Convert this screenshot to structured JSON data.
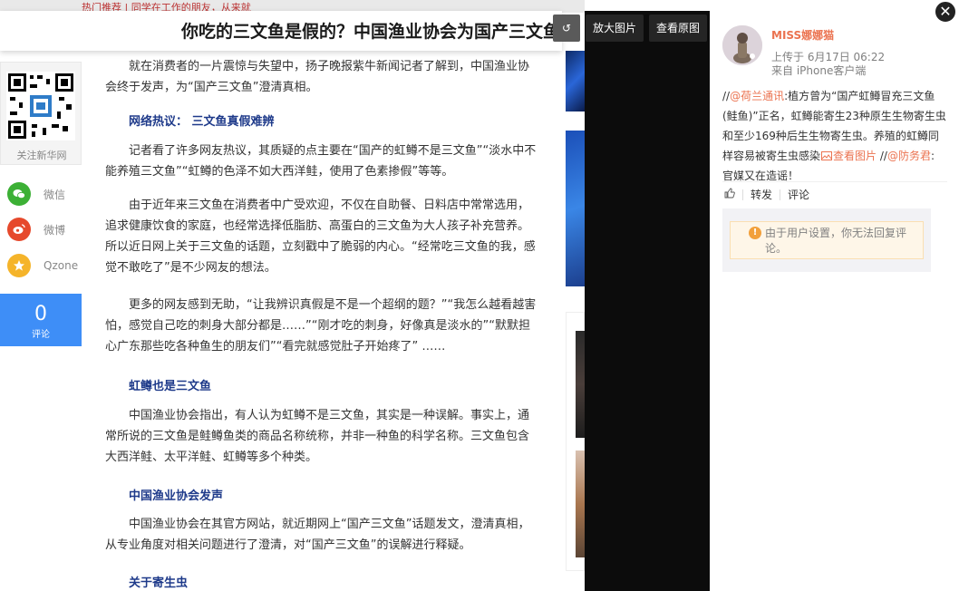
{
  "article": {
    "title": "你吃的三文鱼是假的？中国渔业协会为国产三文鱼正名",
    "top_fragment": "热门推荐 | 同学在工作的朋友，从来就",
    "paragraphs": [
      "就在消费者的一片震惊与失望中，扬子晚报紫牛新闻记者了解到，中国渔业协会终于发声，为“国产三文鱼”澄清真相。",
      "记者看了许多网友热议，其质疑的点主要在“国产的虹鳟不是三文鱼”“淡水中不能养殖三文鱼”“虹鳟的色泽不如大西洋鲑，使用了色素掺假”等等。",
      "由于近年来三文鱼在消费者中广受欢迎，不仅在自助餐、日料店中常常选用，追求健康饮食的家庭，也经常选择低脂肪、高蛋白的三文鱼为大人孩子补充营养。所以近日网上关于三文鱼的话题，立刻戳中了脆弱的内心。“经常吃三文鱼的我，感觉不敢吃了”是不少网友的想法。",
      "更多的网友感到无助，“让我辨识真假是不是一个超纲的题？”“我怎么越看越害怕，感觉自己吃的刺身大部分都是……”“刚才吃的刺身，好像真是淡水的”“默默担心广东那些吃各种鱼生的朋友们”“看完就感觉肚子开始疼了” ……",
      "中国渔业协会指出，有人认为虹鳟不是三文鱼，其实是一种误解。事实上，通常所说的三文鱼是鲑鳟鱼类的商品名称统称，并非一种鱼的科学名称。三文鱼包含大西洋鲑、太平洋鲑、虹鳟等多个种类。",
      "中国渔业协会在其官方网站，就近期网上“国产三文鱼”话题发文，澄清真相，从专业角度对相关问题进行了澄清，对“国产三文鱼”的误解进行释疑。"
    ],
    "subheads": [
      "网络热议： 三文鱼真假难辨",
      "虹鳟也是三文鱼",
      "中国渔业协会发声",
      "关于寄生虫"
    ]
  },
  "share": {
    "qr_label": "关注新华网",
    "items": [
      {
        "label": "微信",
        "icon": "wechat-icon",
        "color": "#3cb035"
      },
      {
        "label": "微博",
        "icon": "weibo-icon",
        "color": "#e6492c"
      },
      {
        "label": "Qzone",
        "icon": "qzone-icon",
        "color": "#f5b42a"
      }
    ],
    "comment_count": "0",
    "comment_label": "评论"
  },
  "viewer": {
    "toolbar": {
      "rotate_label": "↺",
      "enlarge_label": "放大图片",
      "original_label": "查看原图"
    },
    "close_label": "✕"
  },
  "weibo": {
    "username": "MISS娜娜猫",
    "post_time": "上传于 6月17日 06:22",
    "post_source": "来自 iPhone客户端",
    "post_prefix": "//",
    "mention_1": "@荷兰通讯",
    "post_body": ":植方曾为“国产虹鳟冒充三文鱼(鲑鱼)”正名，虹鳟能寄生23种原生生物寄生虫和至少169种后生生物寄生虫。养殖的虹鳟同样容易被寄生虫感染",
    "view_image_link": "查看图片",
    "post_prefix_2": " //",
    "mention_2": "@防务君",
    "post_tail": ": 官媒又在造谣！",
    "actions": {
      "like_label": "👍",
      "repost_label": "转发",
      "comment_label": "评论"
    },
    "notice": "由于用户设置，你无法回复评论。",
    "notice_icon": "!"
  },
  "colors": {
    "accent": "#eb7350",
    "comment_blue": "#3e8ef7",
    "subhead_blue": "#1e3a8a"
  }
}
